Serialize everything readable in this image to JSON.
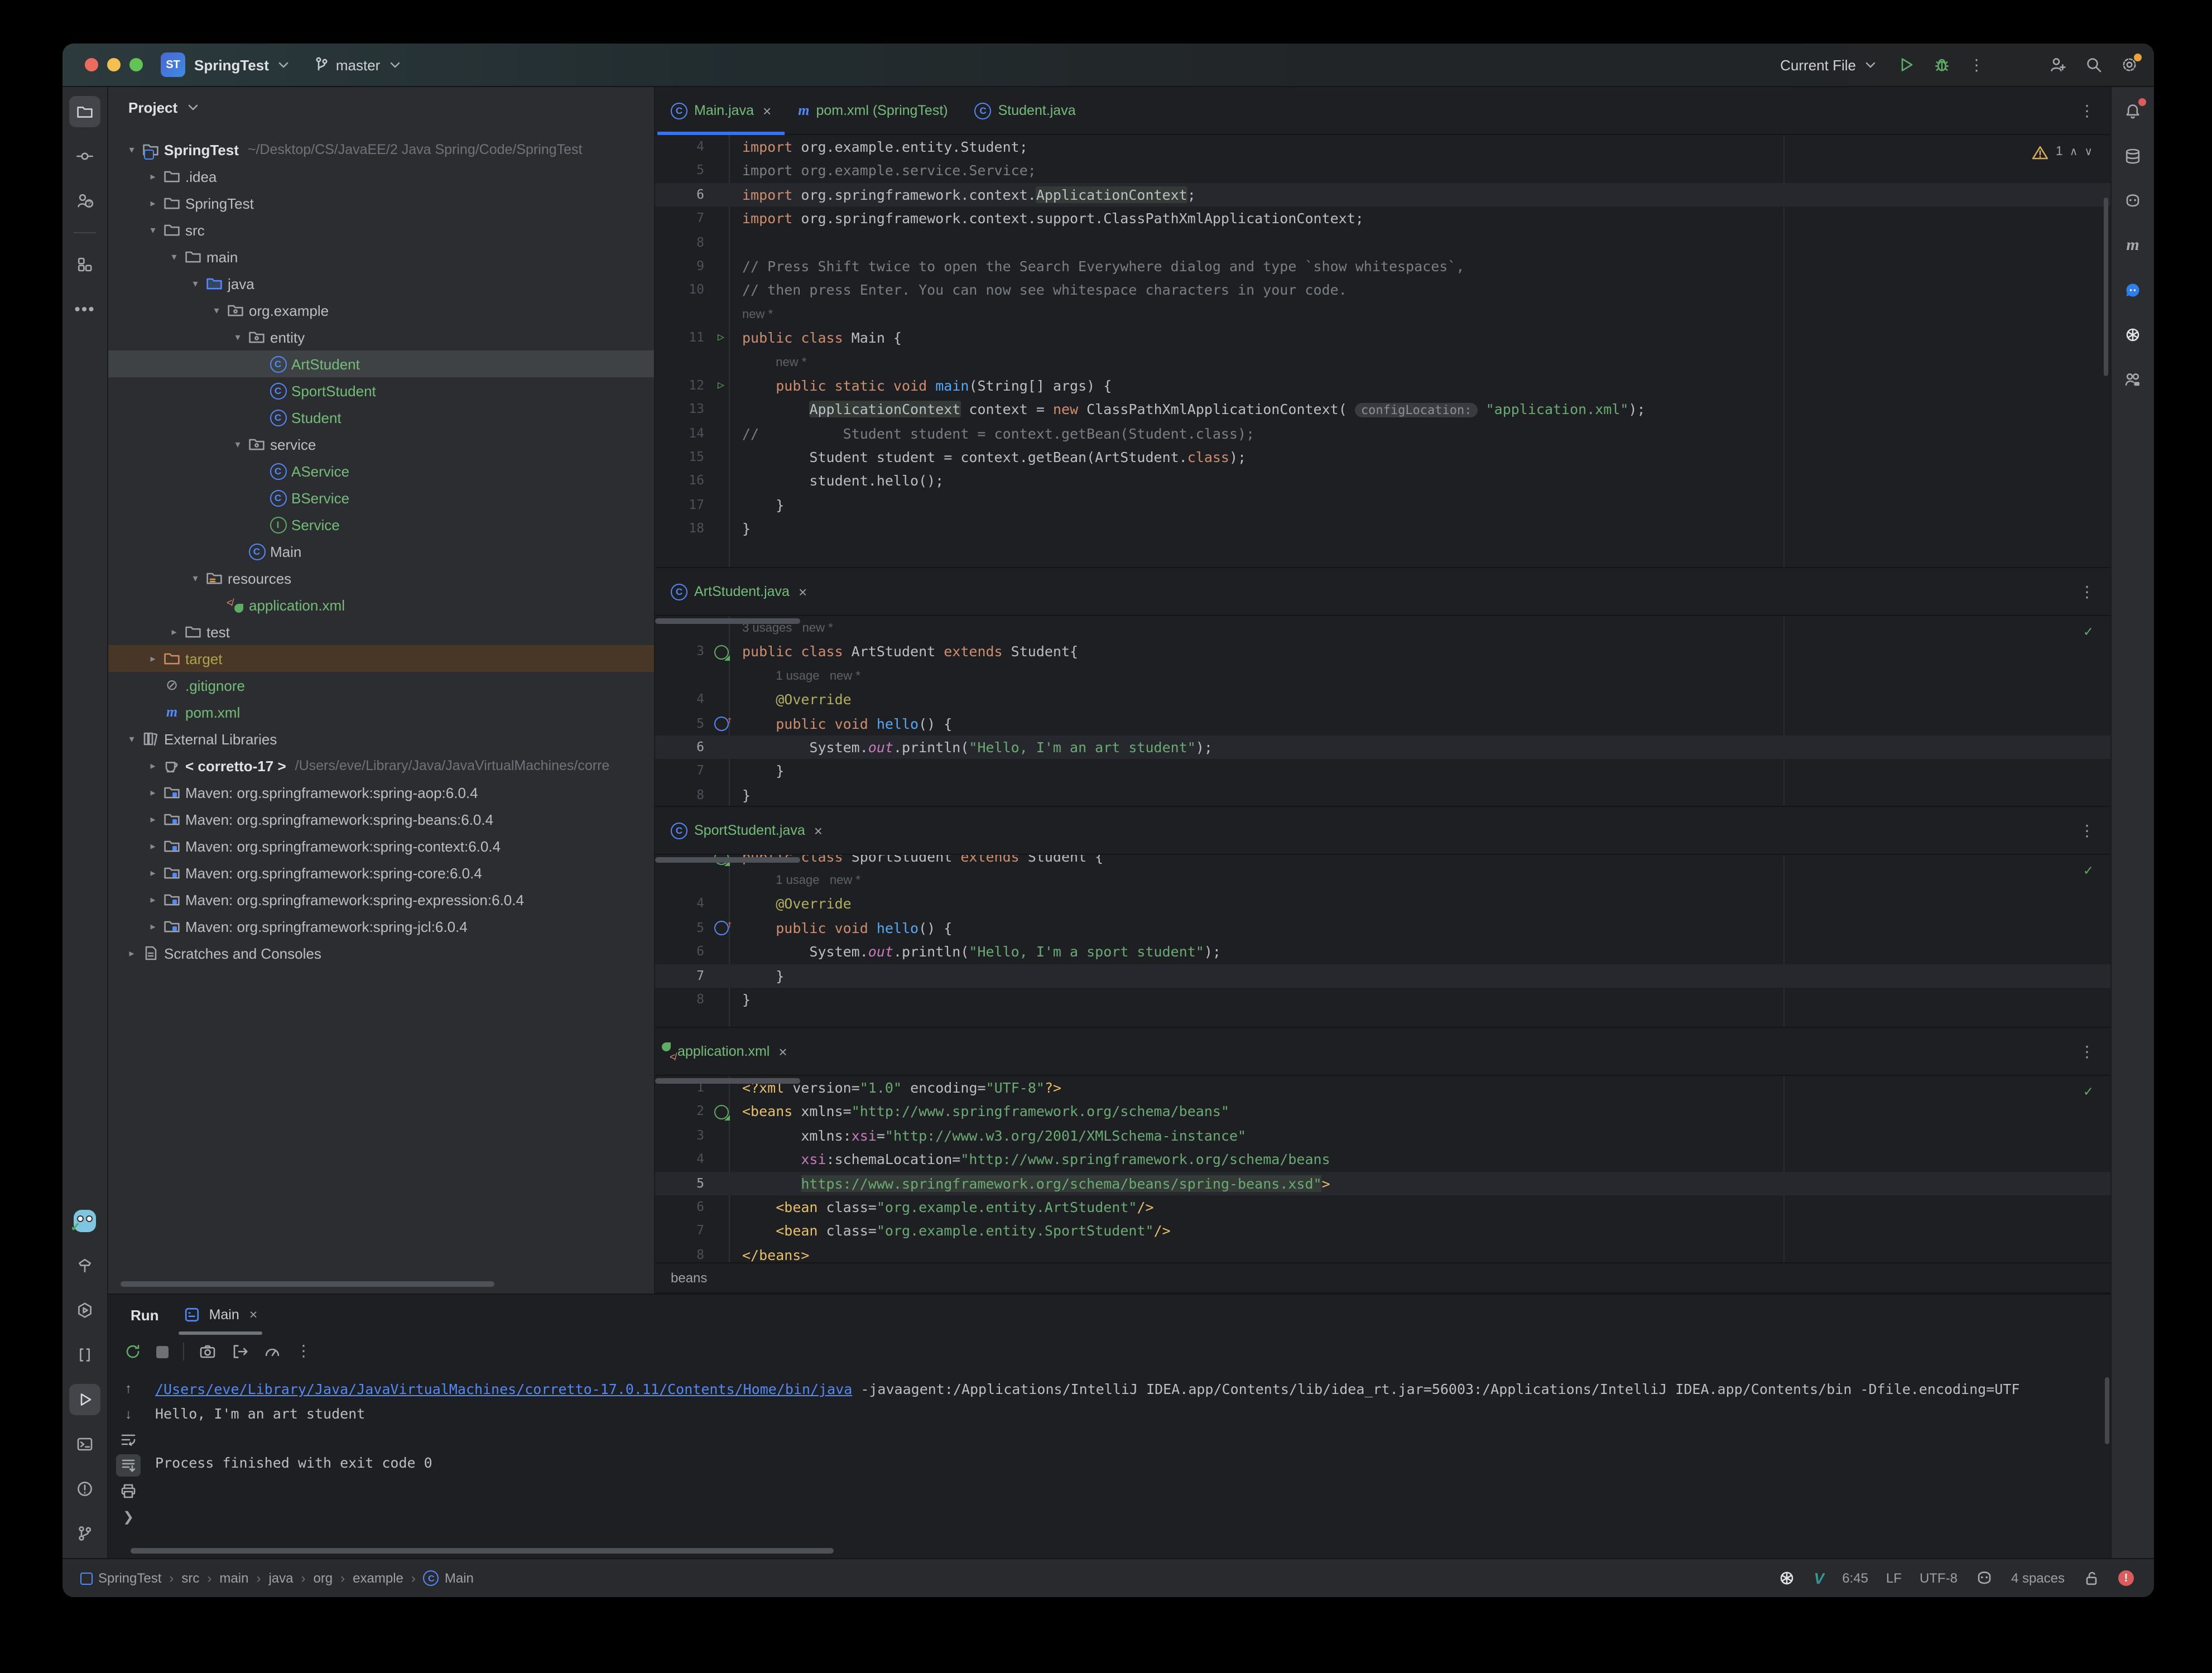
{
  "colors": {
    "accent": "#3574f0",
    "new_file_green": "#73bd79",
    "keyword": "#cf8e6d",
    "string": "#6aab73",
    "link": "#548af7",
    "error": "#db5c5c",
    "warning": "#d6ae58",
    "settings_badge": "#e8a33d"
  },
  "titlebar": {
    "logo": "ST",
    "project": "SpringTest",
    "branch": "master",
    "run_config": "Current File"
  },
  "rails": {
    "left_top": [
      {
        "ic": "folder",
        "name": "project-tool-icon",
        "active": true
      },
      {
        "ic": "commit",
        "name": "commit-icon"
      },
      {
        "ic": "prq",
        "name": "pull-requests-icon"
      },
      {
        "div": true
      },
      {
        "ic": "structure",
        "name": "structure-icon"
      },
      {
        "ic": "more",
        "name": "more-tools-icon"
      }
    ],
    "left_bottom": [
      {
        "ic": "gopher",
        "name": "plugin-gopher-icon"
      },
      {
        "ic": "build",
        "name": "build-icon"
      },
      {
        "ic": "services",
        "name": "services-icon"
      },
      {
        "ic": "brackets",
        "name": "brackets-tool-icon"
      },
      {
        "ic": "play",
        "name": "run-tool-icon",
        "active": true
      },
      {
        "ic": "terminal",
        "name": "terminal-icon"
      },
      {
        "ic": "problems",
        "name": "problems-icon"
      },
      {
        "ic": "git",
        "name": "version-control-icon"
      }
    ],
    "right": [
      {
        "ic": "bell",
        "name": "notifications-icon",
        "dot": true
      },
      {
        "ic": "db",
        "name": "database-icon"
      },
      {
        "ic": "robot",
        "name": "ai-assistant-icon"
      },
      {
        "ic": "mvnrail",
        "name": "maven-tool-icon"
      },
      {
        "ic": "chat",
        "name": "chat-icon"
      },
      {
        "ic": "openai",
        "name": "openai-icon"
      },
      {
        "ic": "cwm",
        "name": "code-with-me-icon"
      }
    ]
  },
  "project_panel": {
    "title": "Project",
    "items": [
      {
        "label": "SpringTest",
        "sub": "~/Desktop/CS/JavaEE/2 Java Spring/Code/SpringTest",
        "level": 0,
        "ch": "d",
        "ic": "proj",
        "bold": true
      },
      {
        "label": ".idea",
        "level": 1,
        "ch": "r",
        "ic": "fold"
      },
      {
        "label": "SpringTest",
        "level": 1,
        "ch": "r",
        "ic": "fold"
      },
      {
        "label": "src",
        "level": 1,
        "ch": "d",
        "ic": "fold"
      },
      {
        "label": "main",
        "level": 2,
        "ch": "d",
        "ic": "fold"
      },
      {
        "label": "java",
        "level": 3,
        "ch": "d",
        "ic": "foldb"
      },
      {
        "label": "org.example",
        "level": 4,
        "ch": "d",
        "ic": "pkg"
      },
      {
        "label": "entity",
        "level": 5,
        "ch": "d",
        "ic": "pkg"
      },
      {
        "label": "ArtStudent",
        "level": 6,
        "ic": "cls",
        "cls": "green",
        "row": "sel"
      },
      {
        "label": "SportStudent",
        "level": 6,
        "ic": "cls",
        "cls": "green"
      },
      {
        "label": "Student",
        "level": 6,
        "ic": "cls",
        "cls": "green"
      },
      {
        "label": "service",
        "level": 5,
        "ch": "d",
        "ic": "pkg"
      },
      {
        "label": "AService",
        "level": 6,
        "ic": "cls",
        "cls": "green"
      },
      {
        "label": "BService",
        "level": 6,
        "ic": "cls",
        "cls": "green"
      },
      {
        "label": "Service",
        "level": 6,
        "ic": "itf",
        "cls": "green"
      },
      {
        "label": "Main",
        "level": 5,
        "ic": "cls"
      },
      {
        "label": "resources",
        "level": 3,
        "ch": "d",
        "ic": "res"
      },
      {
        "label": "application.xml",
        "level": 4,
        "ic": "spr",
        "cls": "green"
      },
      {
        "label": "test",
        "level": 2,
        "ch": "r",
        "ic": "fold"
      },
      {
        "label": "target",
        "level": 1,
        "ch": "r",
        "ic": "tgt",
        "cls": "yellow",
        "row": "excl"
      },
      {
        "label": ".gitignore",
        "level": 1,
        "ic": "ign",
        "cls": "green"
      },
      {
        "label": "pom.xml",
        "level": 1,
        "ic": "mvn",
        "cls": "green"
      },
      {
        "label": "External Libraries",
        "level": 0,
        "ch": "d",
        "ic": "lib"
      },
      {
        "label": "< corretto-17 >",
        "sub": "/Users/eve/Library/Java/JavaVirtualMachines/corre",
        "level": 1,
        "ch": "r",
        "ic": "jdk",
        "bold": true
      },
      {
        "label": "Maven: org.springframework:spring-aop:6.0.4",
        "level": 1,
        "ch": "r",
        "ic": "mlib"
      },
      {
        "label": "Maven: org.springframework:spring-beans:6.0.4",
        "level": 1,
        "ch": "r",
        "ic": "mlib"
      },
      {
        "label": "Maven: org.springframework:spring-context:6.0.4",
        "level": 1,
        "ch": "r",
        "ic": "mlib"
      },
      {
        "label": "Maven: org.springframework:spring-core:6.0.4",
        "level": 1,
        "ch": "r",
        "ic": "mlib"
      },
      {
        "label": "Maven: org.springframework:spring-expression:6.0.4",
        "level": 1,
        "ch": "r",
        "ic": "mlib"
      },
      {
        "label": "Maven: org.springframework:spring-jcl:6.0.4",
        "level": 1,
        "ch": "r",
        "ic": "mlib"
      },
      {
        "label": "Scratches and Consoles",
        "level": 0,
        "ch": "r",
        "ic": "scr"
      }
    ]
  },
  "editor_groups": [
    {
      "tabs": [
        {
          "label": "Main.java",
          "icon": "cls",
          "active": true,
          "close": true
        },
        {
          "label": "pom.xml (SpringTest)",
          "icon": "mvn"
        },
        {
          "label": "Student.java",
          "icon": "cls"
        }
      ],
      "widget": {
        "type": "warn",
        "count": "1"
      },
      "lines": [
        {
          "n": "4",
          "seg": [
            [
              "k",
              "import"
            ],
            [
              "p",
              " org.example.entity.Student;"
            ]
          ]
        },
        {
          "n": "5",
          "seg": [
            [
              "c",
              "import org.example.service.Service;"
            ]
          ]
        },
        {
          "n": "6",
          "cur": true,
          "seg": [
            [
              "k",
              "import"
            ],
            [
              "p",
              " org.springframework.context."
            ],
            [
              "h",
              "ApplicationContext"
            ],
            [
              "p",
              ";"
            ]
          ]
        },
        {
          "n": "7",
          "seg": [
            [
              "k",
              "import"
            ],
            [
              "p",
              " org.springframework.context.support.ClassPathXmlApplicationContext;"
            ]
          ]
        },
        {
          "n": "8",
          "seg": []
        },
        {
          "n": "9",
          "seg": [
            [
              "c",
              "// Press Shift twice to open the Search Everywhere dialog and type `show whitespaces`,"
            ]
          ]
        },
        {
          "n": "10",
          "seg": [
            [
              "c",
              "// then press Enter. You can now see whitespace characters in your code."
            ]
          ]
        },
        {
          "ty": "inlay",
          "text": "new *",
          "ind": 0
        },
        {
          "n": "11",
          "g": "run",
          "seg": [
            [
              "k",
              "public class"
            ],
            [
              "p",
              " Main {"
            ]
          ]
        },
        {
          "ty": "inlay",
          "text": "new *",
          "ind": 4
        },
        {
          "n": "12",
          "g": "run",
          "seg": [
            [
              "p",
              "    "
            ],
            [
              "k",
              "public static void "
            ],
            [
              "m",
              "main"
            ],
            [
              "p",
              "(String[] args) {"
            ]
          ]
        },
        {
          "n": "13",
          "seg": [
            [
              "p",
              "        "
            ],
            [
              "h",
              "ApplicationContext"
            ],
            [
              "p",
              " context = "
            ],
            [
              "k",
              "new"
            ],
            [
              "p",
              " ClassPathXmlApplicationContext( "
            ],
            [
              "i",
              "configLocation:"
            ],
            [
              "p",
              " "
            ],
            [
              "s",
              "\"application.xml\""
            ],
            [
              "p",
              ");"
            ]
          ]
        },
        {
          "n": "14",
          "seg": [
            [
              "c",
              "//          Student student = context.getBean(Student.class);"
            ]
          ]
        },
        {
          "n": "15",
          "seg": [
            [
              "p",
              "        Student student = context.getBean(ArtStudent."
            ],
            [
              "k",
              "class"
            ],
            [
              "p",
              ");"
            ]
          ]
        },
        {
          "n": "16",
          "seg": [
            [
              "p",
              "        student.hello();"
            ]
          ]
        },
        {
          "n": "17",
          "seg": [
            [
              "p",
              "    }"
            ]
          ]
        },
        {
          "n": "18",
          "seg": [
            [
              "p",
              "}"
            ]
          ]
        }
      ]
    },
    {
      "tabs": [
        {
          "label": "ArtStudent.java",
          "icon": "cls",
          "close": true
        }
      ],
      "widget": {
        "type": "ok"
      },
      "pill": true,
      "lines": [
        {
          "ty": "inlay",
          "text": "3 usages   new *",
          "ind": 0
        },
        {
          "n": "3",
          "g": "bean",
          "seg": [
            [
              "k",
              "public class"
            ],
            [
              "p",
              " ArtStudent "
            ],
            [
              "k",
              "extends"
            ],
            [
              "p",
              " Student{"
            ]
          ]
        },
        {
          "ty": "inlay",
          "text": "1 usage   new *",
          "ind": 4
        },
        {
          "n": "4",
          "seg": [
            [
              "p",
              "    "
            ],
            [
              "a",
              "@Override"
            ]
          ]
        },
        {
          "n": "5",
          "g": "override",
          "seg": [
            [
              "p",
              "    "
            ],
            [
              "k",
              "public void "
            ],
            [
              "m",
              "hello"
            ],
            [
              "p",
              "() {"
            ]
          ]
        },
        {
          "n": "6",
          "cur": true,
          "seg": [
            [
              "p",
              "        System."
            ],
            [
              "f",
              "out"
            ],
            [
              "p",
              ".println("
            ],
            [
              "s",
              "\"Hello, I'm an art student\""
            ],
            [
              "p",
              ");"
            ]
          ]
        },
        {
          "n": "7",
          "seg": [
            [
              "p",
              "    }"
            ]
          ]
        },
        {
          "n": "8",
          "seg": [
            [
              "p",
              "}"
            ]
          ]
        }
      ]
    },
    {
      "tabs": [
        {
          "label": "SportStudent.java",
          "icon": "cls",
          "close": true
        }
      ],
      "widget": {
        "type": "ok"
      },
      "pill": true,
      "lines": [
        {
          "ty": "clip",
          "g": "bean",
          "seg": [
            [
              "k",
              "public class"
            ],
            [
              "p",
              " SportStudent "
            ],
            [
              "k",
              "extends"
            ],
            [
              "p",
              " Student {"
            ]
          ]
        },
        {
          "ty": "inlay",
          "text": "1 usage   new *",
          "ind": 4
        },
        {
          "n": "4",
          "seg": [
            [
              "p",
              "    "
            ],
            [
              "a",
              "@Override"
            ]
          ]
        },
        {
          "n": "5",
          "g": "override",
          "seg": [
            [
              "p",
              "    "
            ],
            [
              "k",
              "public void "
            ],
            [
              "m",
              "hello"
            ],
            [
              "p",
              "() {"
            ]
          ]
        },
        {
          "n": "6",
          "seg": [
            [
              "p",
              "        System."
            ],
            [
              "f",
              "out"
            ],
            [
              "p",
              ".println("
            ],
            [
              "s",
              "\"Hello, I'm a sport student\""
            ],
            [
              "p",
              ");"
            ]
          ]
        },
        {
          "n": "7",
          "cur": true,
          "seg": [
            [
              "p",
              "    }"
            ]
          ]
        },
        {
          "n": "8",
          "seg": [
            [
              "p",
              "}"
            ]
          ]
        }
      ]
    },
    {
      "tabs": [
        {
          "label": "application.xml",
          "icon": "spr",
          "close": true
        }
      ],
      "widget": {
        "type": "ok"
      },
      "pill": true,
      "breadcrumb": "beans",
      "lines": [
        {
          "n": "1",
          "seg": [
            [
              "T",
              "<?xml "
            ],
            [
              "p",
              "version="
            ],
            [
              "s",
              "\"1.0\""
            ],
            [
              "p",
              " encoding="
            ],
            [
              "s",
              "\"UTF-8\""
            ],
            [
              "T",
              "?>"
            ]
          ]
        },
        {
          "n": "2",
          "g": "bean",
          "seg": [
            [
              "T",
              "<beans"
            ],
            [
              "p",
              " xmlns="
            ],
            [
              "s",
              "\"http://www.springframework.org/schema/beans\""
            ]
          ]
        },
        {
          "n": "3",
          "seg": [
            [
              "p",
              "       xmlns:"
            ],
            [
              "n",
              "xsi"
            ],
            [
              "p",
              "="
            ],
            [
              "s",
              "\"http://www.w3.org/2001/XMLSchema-instance\""
            ]
          ]
        },
        {
          "n": "4",
          "seg": [
            [
              "p",
              "       "
            ],
            [
              "n",
              "xsi"
            ],
            [
              "p",
              ":schemaLocation="
            ],
            [
              "s",
              "\"http://www.springframework.org/schema/beans"
            ]
          ]
        },
        {
          "n": "5",
          "cur": true,
          "seg": [
            [
              "p",
              "       "
            ],
            [
              "S",
              "https://www.springframework.org/schema/beans/spring-beans.xsd\""
            ],
            [
              "T",
              ">"
            ]
          ]
        },
        {
          "n": "6",
          "seg": [
            [
              "p",
              "    "
            ],
            [
              "T",
              "<bean"
            ],
            [
              "p",
              " class="
            ],
            [
              "s",
              "\"org.example.entity.ArtStudent\""
            ],
            [
              "T",
              "/>"
            ]
          ]
        },
        {
          "n": "7",
          "seg": [
            [
              "p",
              "    "
            ],
            [
              "T",
              "<bean"
            ],
            [
              "p",
              " class="
            ],
            [
              "s",
              "\"org.example.entity.SportStudent\""
            ],
            [
              "T",
              "/>"
            ]
          ]
        },
        {
          "n": "8",
          "seg": [
            [
              "T",
              "</beans>"
            ]
          ]
        }
      ]
    }
  ],
  "run_panel": {
    "label": "Run",
    "tab": "Main",
    "console": [
      [
        [
          "l",
          "/Users/eve/Library/Java/JavaVirtualMachines/corretto-17.0.11/Contents/Home/bin/java"
        ],
        [
          "p",
          " -javaagent:/Applications/IntelliJ IDEA.app/Contents/lib/idea_rt.jar=56003:/Applications/IntelliJ IDEA.app/Contents/bin -Dfile.encoding=UTF"
        ]
      ],
      [
        [
          "p",
          "Hello, I'm an art student"
        ]
      ],
      [],
      [
        [
          "p",
          "Process finished with exit code 0"
        ]
      ]
    ]
  },
  "status_bar": {
    "breadcrumbs": [
      "SpringTest",
      "src",
      "main",
      "java",
      "org",
      "example",
      "Main"
    ],
    "caret": "6:45",
    "line_sep": "LF",
    "encoding": "UTF-8",
    "indent": "4 spaces"
  }
}
